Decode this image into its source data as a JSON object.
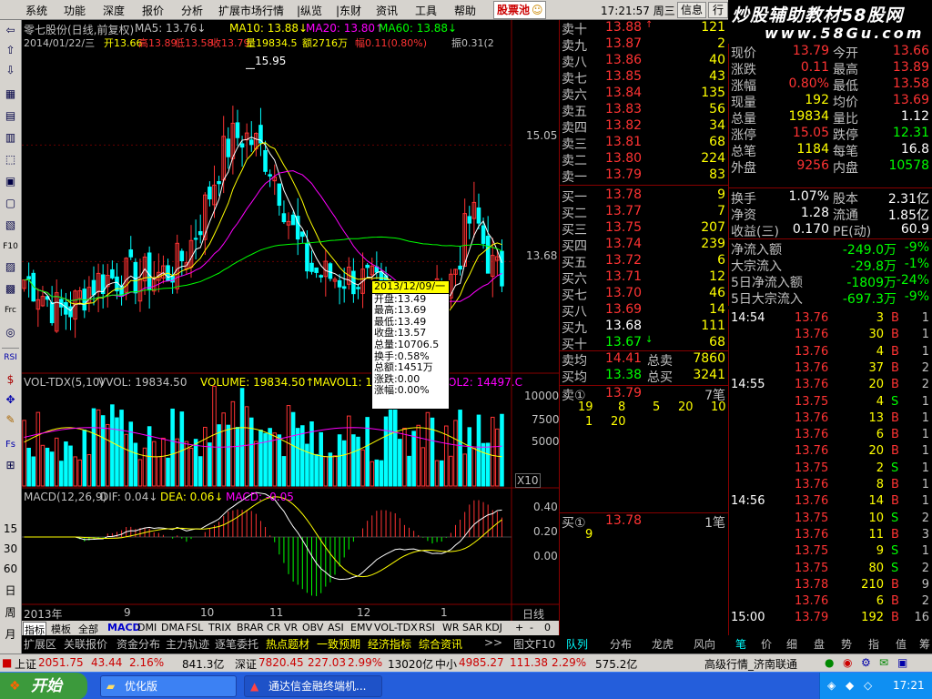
{
  "menu": {
    "items": [
      "系统",
      "功能",
      "深度",
      "报价",
      "分析",
      "扩展市场行情",
      "|纵览",
      "|东财",
      "资讯",
      "工具",
      "帮助"
    ],
    "pool_label": "股票池",
    "clock": "17:21:57 周三",
    "btn_message": "信息",
    "btn_row": "行"
  },
  "logo": {
    "line1": "炒股辅助教材58股网",
    "line2": "www.58Gu.com"
  },
  "chart": {
    "title": "零七股份(日线,前复权)",
    "ma5": "MA5: 13.76↓",
    "ma10": "MA10: 13.88↓",
    "ma20": "MA20: 13.80↑",
    "ma60": "MA60: 13.88↓",
    "ohlc_line": {
      "date": "2014/01/22/三",
      "open": "开13.66",
      "high": "高13.89",
      "low": "低13.58",
      "close": "收13.79",
      "volume": "量19834.5",
      "amount": "额2716万",
      "change": "幅0.11(0.80%)",
      "amplitude": "振0.31(2"
    },
    "high_mark": "15.95",
    "price_ticks": [
      "15.05",
      "13.68"
    ],
    "vol_header": {
      "name": "VOL-TDX(5,10)",
      "vvol": "VVOL: 19834.50",
      "volume": "VOLUME: 19834.50↑",
      "mavol1": "MAVOL1: 11",
      "mavol2": "OL2: 14497.C"
    },
    "vol_ticks": [
      "10000",
      "7500",
      "5000"
    ],
    "vol_unit": "X10",
    "macd_header": {
      "name": "MACD(12,26,9)",
      "dif": "DIF: 0.04↓",
      "dea": "DEA: 0.06↓",
      "macd": "MACD: -0.05"
    },
    "macd_ticks": [
      "0.40",
      "0.20",
      "0.00"
    ],
    "x_labels": [
      "2013年",
      "9",
      "10",
      "11",
      "12",
      "1"
    ],
    "period": "日线",
    "tooltip": {
      "date": "2013/12/09/一",
      "lines": [
        "开盘:13.49",
        "最高:13.69",
        "最低:13.49",
        "收盘:13.57",
        "总量:10706.5",
        "换手:0.58%",
        "总额:1451万",
        "涨跌:0.00",
        "涨幅:0.00%"
      ]
    }
  },
  "chart_data": {
    "type": "bar",
    "title": "零七股份(日线,前复权)",
    "description_series": [
      {
        "name": "MA5",
        "last": 13.76
      },
      {
        "name": "MA10",
        "last": 13.88
      },
      {
        "name": "MA20",
        "last": 13.8
      },
      {
        "name": "MA60",
        "last": 13.88
      }
    ],
    "ylim": [
      12.4,
      16.2
    ],
    "price_ticks": [
      15.05,
      13.68
    ],
    "high": 15.95,
    "last_close": 13.79,
    "volume_ticks": [
      10000,
      7500,
      5000
    ],
    "volume_last": 19834.5,
    "macd_ticks": [
      0.4,
      0.2,
      0.0
    ],
    "macd": {
      "dif": 0.04,
      "dea": 0.06,
      "macd": -0.05
    }
  },
  "left_toolbar": [
    "⇦",
    "⇧",
    "⇩",
    "▦",
    "▤",
    "▥",
    "⬚",
    "▣",
    "▢",
    "▧",
    "F10",
    "▨",
    "▩",
    "Frc",
    "◎",
    "",
    "RSI",
    "$",
    "✥",
    "✎",
    "Fs",
    "⊞",
    "15",
    "30",
    "60",
    "日",
    "周",
    "月"
  ],
  "tabs": [
    "指标",
    "模板",
    "全部",
    "MACD",
    "DMI",
    "DMA",
    "FSL",
    "TRIX",
    "BRAR",
    "CR",
    "VR",
    "OBV",
    "ASI",
    "EMV",
    "VOL-TDX",
    "RSI",
    "WR",
    "SAR",
    "KDJ",
    "+",
    "-",
    "0"
  ],
  "subtabs": [
    "扩展区",
    "关联报价",
    "资金分布",
    "主力轨迹",
    "逐笔委托",
    "热点题材",
    "一致预期",
    "经济指标",
    "综合资讯",
    ">>",
    "图文F10"
  ],
  "quote": {
    "asks": [
      {
        "label": "卖十",
        "price": "13.88",
        "vol": "121",
        "mark": "↑"
      },
      {
        "label": "卖九",
        "price": "13.87",
        "vol": "2",
        "mark": ""
      },
      {
        "label": "卖八",
        "price": "13.86",
        "vol": "40",
        "mark": ""
      },
      {
        "label": "卖七",
        "price": "13.85",
        "vol": "43",
        "mark": ""
      },
      {
        "label": "卖六",
        "price": "13.84",
        "vol": "135",
        "mark": ""
      },
      {
        "label": "卖五",
        "price": "13.83",
        "vol": "56",
        "mark": ""
      },
      {
        "label": "卖四",
        "price": "13.82",
        "vol": "34",
        "mark": ""
      },
      {
        "label": "卖三",
        "price": "13.81",
        "vol": "68",
        "mark": ""
      },
      {
        "label": "卖二",
        "price": "13.80",
        "vol": "224",
        "mark": ""
      },
      {
        "label": "卖一",
        "price": "13.79",
        "vol": "83",
        "mark": ""
      }
    ],
    "bids": [
      {
        "label": "买一",
        "price": "13.78",
        "vol": "9",
        "mark": ""
      },
      {
        "label": "买二",
        "price": "13.77",
        "vol": "7",
        "mark": ""
      },
      {
        "label": "买三",
        "price": "13.75",
        "vol": "207",
        "mark": ""
      },
      {
        "label": "买四",
        "price": "13.74",
        "vol": "239",
        "mark": ""
      },
      {
        "label": "买五",
        "price": "13.72",
        "vol": "6",
        "mark": ""
      },
      {
        "label": "买六",
        "price": "13.71",
        "vol": "12",
        "mark": ""
      },
      {
        "label": "买七",
        "price": "13.70",
        "vol": "46",
        "mark": ""
      },
      {
        "label": "买八",
        "price": "13.69",
        "vol": "14",
        "mark": ""
      },
      {
        "label": "买九",
        "price": "13.68",
        "vol": "111",
        "mark": ""
      },
      {
        "label": "买十",
        "price": "13.67",
        "vol": "68",
        "mark": "↓"
      }
    ],
    "avg_sell": {
      "label": "卖均",
      "price": "14.41",
      "tlabel": "总卖",
      "total": "7860"
    },
    "avg_buy": {
      "label": "买均",
      "price": "13.38",
      "tlabel": "总买",
      "total": "3241"
    },
    "sell1_detail": {
      "label": "卖①",
      "price": "13.79",
      "count": "7笔",
      "q1": [
        "19",
        "8",
        "5",
        "20",
        "10"
      ],
      "q2": [
        "1",
        "20"
      ]
    },
    "buy1_detail": {
      "label": "买①",
      "price": "13.78",
      "count": "1笔",
      "q1": [
        "9"
      ]
    },
    "bottom_tabs": [
      "队列",
      "分布",
      "龙虎",
      "风向"
    ]
  },
  "info": {
    "rows": [
      {
        "l1": "现价",
        "v1": "13.79",
        "l2": "今开",
        "v2": "13.66"
      },
      {
        "l1": "涨跌",
        "v1": "0.11",
        "l2": "最高",
        "v2": "13.89"
      },
      {
        "l1": "涨幅",
        "v1": "0.80%",
        "l2": "最低",
        "v2": "13.58"
      },
      {
        "l1": "现量",
        "v1": "192",
        "l2": "均价",
        "v2": "13.69"
      },
      {
        "l1": "总量",
        "v1": "19834",
        "l2": "量比",
        "v2": "1.12"
      },
      {
        "l1": "涨停",
        "v1": "15.05",
        "l2": "跌停",
        "v2": "12.31"
      },
      {
        "l1": "总笔",
        "v1": "1184",
        "l2": "每笔",
        "v2": "16.8"
      },
      {
        "l1": "外盘",
        "v1": "9256",
        "l2": "内盘",
        "v2": "10578"
      },
      {
        "l1": "换手",
        "v1": "1.07%",
        "l2": "股本",
        "v2": "2.31亿"
      },
      {
        "l1": "净资",
        "v1": "1.28",
        "l2": "流通",
        "v2": "1.85亿"
      },
      {
        "l1": "收益(三)",
        "v1": "0.170",
        "l2": "PE(动)",
        "v2": "60.9"
      }
    ],
    "flows": [
      {
        "label": "净流入额",
        "value": "-249.0万",
        "pct": "-9%"
      },
      {
        "label": "大宗流入",
        "value": "-29.8万",
        "pct": "-1%"
      },
      {
        "label": "5日净流入额",
        "value": "-1809万",
        "pct": "-24%"
      },
      {
        "label": "5日大宗流入",
        "value": "-697.3万",
        "pct": "-9%"
      }
    ]
  },
  "ticks": [
    {
      "t": "14:54",
      "p": "13.76",
      "v": "3",
      "bs": "B",
      "n": "1"
    },
    {
      "t": "",
      "p": "13.76",
      "v": "30",
      "bs": "B",
      "n": "1"
    },
    {
      "t": "",
      "p": "13.76",
      "v": "4",
      "bs": "B",
      "n": "1"
    },
    {
      "t": "",
      "p": "13.76",
      "v": "37",
      "bs": "B",
      "n": "2"
    },
    {
      "t": "14:55",
      "p": "13.76",
      "v": "20",
      "bs": "B",
      "n": "2"
    },
    {
      "t": "",
      "p": "13.75",
      "v": "4",
      "bs": "S",
      "n": "1"
    },
    {
      "t": "",
      "p": "13.76",
      "v": "13",
      "bs": "B",
      "n": "1"
    },
    {
      "t": "",
      "p": "13.76",
      "v": "6",
      "bs": "B",
      "n": "1"
    },
    {
      "t": "",
      "p": "13.76",
      "v": "20",
      "bs": "B",
      "n": "1"
    },
    {
      "t": "",
      "p": "13.75",
      "v": "2",
      "bs": "S",
      "n": "1"
    },
    {
      "t": "",
      "p": "13.76",
      "v": "8",
      "bs": "B",
      "n": "1"
    },
    {
      "t": "14:56",
      "p": "13.76",
      "v": "14",
      "bs": "B",
      "n": "1"
    },
    {
      "t": "",
      "p": "13.75",
      "v": "10",
      "bs": "S",
      "n": "2"
    },
    {
      "t": "",
      "p": "13.76",
      "v": "11",
      "bs": "B",
      "n": "3"
    },
    {
      "t": "",
      "p": "13.75",
      "v": "9",
      "bs": "S",
      "n": "1"
    },
    {
      "t": "",
      "p": "13.75",
      "v": "80",
      "bs": "S",
      "n": "2"
    },
    {
      "t": "",
      "p": "13.78",
      "v": "210",
      "bs": "B",
      "n": "9"
    },
    {
      "t": "",
      "p": "13.76",
      "v": "6",
      "bs": "B",
      "n": "2"
    },
    {
      "t": "15:00",
      "p": "13.79",
      "v": "192",
      "bs": "B",
      "n": "16"
    }
  ],
  "ticks_bottom_tabs": [
    "笔",
    "价",
    "细",
    "盘",
    "势",
    "指",
    "值",
    "筹"
  ],
  "status": {
    "sh_label": "上证",
    "sh_val": "2051.75",
    "sh_chg": "43.44",
    "sh_pct": "2.16%",
    "sh_amt": "841.3亿",
    "sz_label": "深证",
    "sz_val": "7820.45",
    "sz_chg": "227.03",
    "sz_pct": "2.99%",
    "sz_amt": "13020亿",
    "zx_label": "中小",
    "zx_val": "4985.27",
    "zx_chg": "111.38",
    "zx_pct": "2.29%",
    "zx_amt": "575.2亿",
    "conn": "高级行情_济南联通"
  },
  "taskbar": {
    "start": "开始",
    "task1": "优化版",
    "task2": "通达信金融终端机...",
    "tray_time": "17:21"
  }
}
